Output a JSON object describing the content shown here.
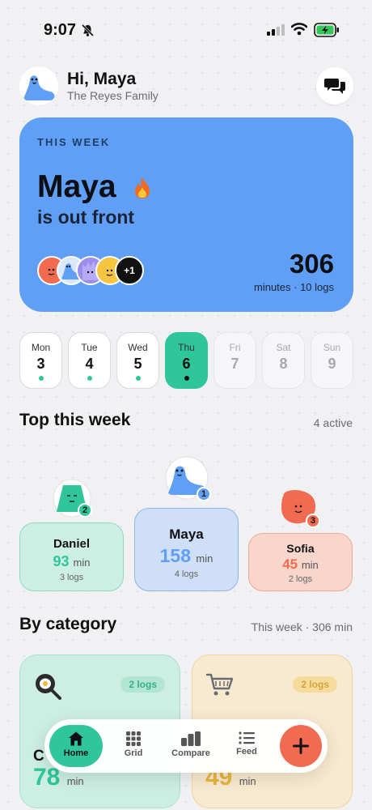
{
  "status_bar": {
    "time": "9:07"
  },
  "header": {
    "greeting": "Hi, Maya",
    "family": "The Reyes Family"
  },
  "hero": {
    "label": "THIS WEEK",
    "leader": "Maya",
    "subtitle": "is out front",
    "extra_members": "+1",
    "total_minutes": "306",
    "summary": "minutes · 10 logs"
  },
  "days": [
    {
      "name": "Mon",
      "num": "3",
      "logged": true,
      "state": "past"
    },
    {
      "name": "Tue",
      "num": "4",
      "logged": true,
      "state": "past"
    },
    {
      "name": "Wed",
      "num": "5",
      "logged": true,
      "state": "past"
    },
    {
      "name": "Thu",
      "num": "6",
      "logged": true,
      "state": "today"
    },
    {
      "name": "Fri",
      "num": "7",
      "logged": false,
      "state": "future"
    },
    {
      "name": "Sat",
      "num": "8",
      "logged": false,
      "state": "future"
    },
    {
      "name": "Sun",
      "num": "9",
      "logged": false,
      "state": "future"
    }
  ],
  "leaderboard": {
    "title": "Top this week",
    "meta": "4 active",
    "entries": [
      {
        "rank": "1",
        "name": "Maya",
        "minutes": "158",
        "unit": "min",
        "logs": "4 logs",
        "color": "#5fa0f6"
      },
      {
        "rank": "2",
        "name": "Daniel",
        "minutes": "93",
        "unit": "min",
        "logs": "3 logs",
        "color": "#2ec69a"
      },
      {
        "rank": "3",
        "name": "Sofia",
        "minutes": "45",
        "unit": "min",
        "logs": "2 logs",
        "color": "#f26a4f"
      }
    ]
  },
  "categories": {
    "title": "By category",
    "meta": "This week · 306 min",
    "items": [
      {
        "icon": "frying-pan-icon",
        "badge": "2 logs",
        "name": "C",
        "minutes": "78",
        "unit": "min",
        "color": "#2ec69a"
      },
      {
        "icon": "shopping-cart-icon",
        "badge": "2 logs",
        "name": "",
        "minutes": "49",
        "unit": "min",
        "color": "#eab43d"
      }
    ]
  },
  "nav": {
    "home": "Home",
    "grid": "Grid",
    "compare": "Compare",
    "feed": "Feed",
    "add_icon": "plus-icon"
  },
  "colors": {
    "accent_green": "#2ec69a",
    "hero_blue": "#5fa0f6",
    "coral": "#f26a4f",
    "amber": "#eab43d"
  }
}
